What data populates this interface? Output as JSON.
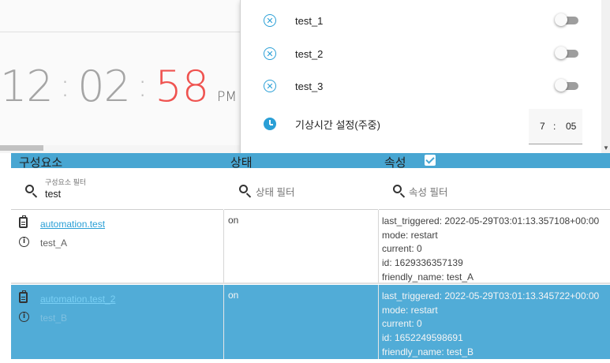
{
  "clock": {
    "hours": "12",
    "minutes": "02",
    "seconds": "58",
    "ampm": "PM",
    "sep1": ":",
    "sep2": ":"
  },
  "panel": {
    "items": [
      {
        "label": "test_1",
        "icon": "cancel-icon",
        "toggle": false
      },
      {
        "label": "test_2",
        "icon": "cancel-icon",
        "toggle": false
      },
      {
        "label": "test_3",
        "icon": "cancel-icon",
        "toggle": false
      }
    ],
    "wake_label": "기상시간 설정(주중)",
    "wake_hour": "7",
    "wake_sep": ":",
    "wake_minute": "05"
  },
  "table": {
    "headers": {
      "entity": "구성요소",
      "state": "상태",
      "attributes": "속성"
    },
    "attributes_checked": true,
    "filters": {
      "entity_label": "구성요소 필터",
      "entity_value": "test",
      "state_placeholder": "상태 필터",
      "attributes_placeholder": "속성 필터"
    },
    "rows": [
      {
        "entity_id": "automation.test",
        "friendly": "test_A",
        "state": "on",
        "attrs": [
          "last_triggered: 2022-05-29T03:01:13.357108+00:00",
          "mode: restart",
          "current: 0",
          "id: 1629336357139",
          "friendly_name: test_A"
        ]
      },
      {
        "entity_id": "automation.test_2",
        "friendly": "test_B",
        "state": "on",
        "attrs": [
          "last_triggered: 2022-05-29T03:01:13.345722+00:00",
          "mode: restart",
          "current: 0",
          "id: 1652249598691",
          "friendly_name: test_B"
        ]
      }
    ]
  },
  "colors": {
    "accent": "#2a9fd6",
    "header_bg": "#48a6d2",
    "highlight_row": "#51acd7",
    "seconds": "#ef5350"
  }
}
